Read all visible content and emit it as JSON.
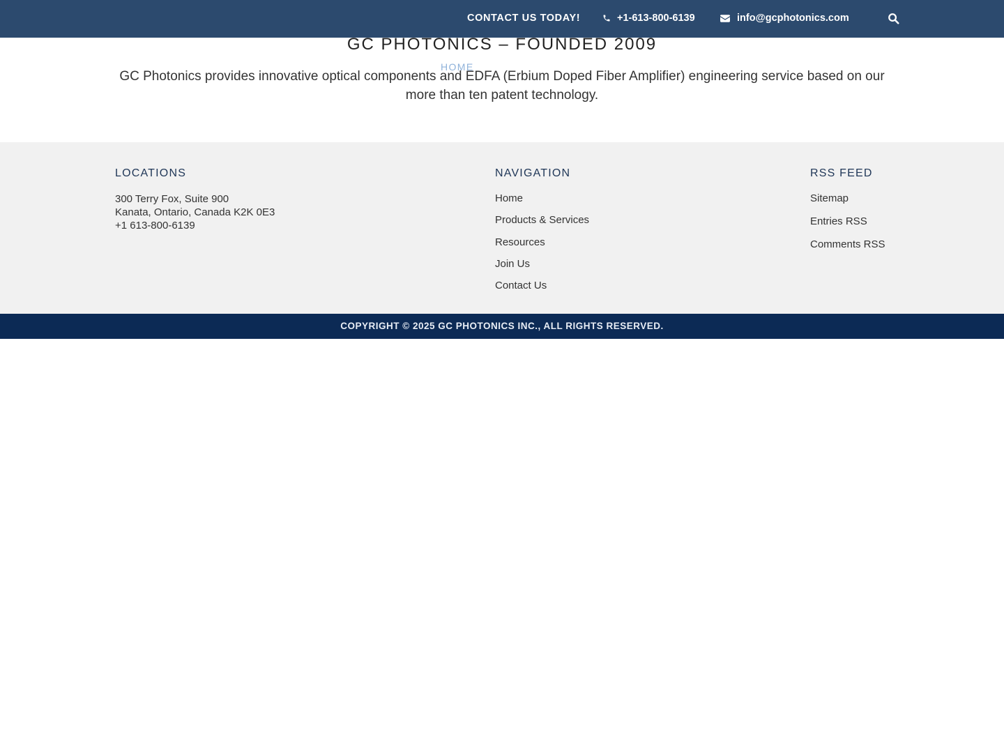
{
  "topbar": {
    "contact_cta": "CONTACT US TODAY!",
    "phone": "+1-613-800-6139",
    "email": "info@gcphotonics.com",
    "icons": {
      "phone": "phone-icon",
      "email": "envelope-icon",
      "search": "search-icon"
    }
  },
  "intro": {
    "title": "GC PHOTONICS – FOUNDED 2009",
    "nav_home": "HOME",
    "text": "GC Photonics provides innovative optical components and EDFA (Erbium Doped Fiber Amplifier) engineering service based on our more than ten patent technology."
  },
  "footer": {
    "locations": {
      "heading": "LOCATIONS",
      "line1": "300 Terry Fox, Suite 900",
      "line2": "Kanata, Ontario, Canada K2K 0E3",
      "line3": "+1 613-800-6139"
    },
    "navigation": {
      "heading": "NAVIGATION",
      "items": [
        "Home",
        "Products & Services",
        "Resources",
        "Join Us",
        "Contact Us"
      ]
    },
    "rss": {
      "heading": "RSS FEED",
      "items": [
        "Sitemap",
        "Entries RSS",
        "Comments RSS"
      ]
    }
  },
  "copyright": "COPYRIGHT © 2025 GC PHOTONICS INC., ALL RIGHTS RESERVED.",
  "colors": {
    "topbar_bg": "#2c4a6e",
    "footer_bg": "#f1f1f1",
    "copyright_bg": "#0c2a55",
    "heading": "#1f3657",
    "nav_link_light": "#8fb2da"
  }
}
